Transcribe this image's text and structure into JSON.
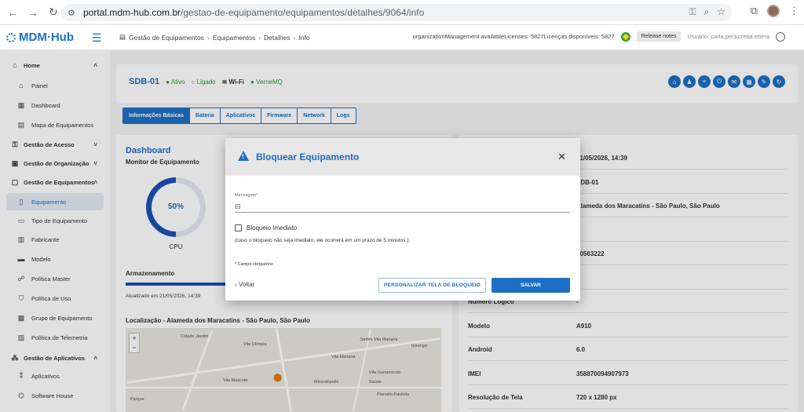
{
  "browser": {
    "url_host": "portal.mdm-hub.com.br",
    "url_path": "/gestao-de-equipamento/equipamentos/detalhes/9064/info"
  },
  "app": {
    "logo": "MDM·Hub",
    "breadcrumb": [
      "Gestão de Equipamentos",
      "Equipamentos",
      "Detalhes",
      "Info"
    ],
    "licenses_text": "organizationManagement.availableLicenses: 5827Licenças disponíveis: 5827",
    "release_notes": "Release notes",
    "user": "Usuário: carla.perazzetta.ettera"
  },
  "sidebar": {
    "items": [
      {
        "label": "Home",
        "icon": "home-icon",
        "type": "group",
        "chevron": "˄"
      },
      {
        "label": "Painel",
        "icon": "home-icon",
        "type": "child"
      },
      {
        "label": "Dashboard",
        "icon": "dashboard-icon",
        "type": "child"
      },
      {
        "label": "Mapa de Equipamentos",
        "icon": "map-icon",
        "type": "child"
      },
      {
        "label": "Gestão de Acesso",
        "icon": "access-icon",
        "type": "group",
        "chevron": "˅"
      },
      {
        "label": "Gestão de Organização",
        "icon": "organization-icon",
        "type": "group",
        "chevron": "˅"
      },
      {
        "label": "Gestão de Equipamentos",
        "icon": "equipment-icon",
        "type": "group",
        "chevron": "˄"
      },
      {
        "label": "Equipamento",
        "icon": "device-icon",
        "type": "child",
        "active": true
      },
      {
        "label": "Tipo de Equipamento",
        "icon": "device-type-icon",
        "type": "child"
      },
      {
        "label": "Fabricante",
        "icon": "manufacturer-icon",
        "type": "child"
      },
      {
        "label": "Modelo",
        "icon": "model-icon",
        "type": "child"
      },
      {
        "label": "Política Master",
        "icon": "policy-icon",
        "type": "child"
      },
      {
        "label": "Política de Uso",
        "icon": "shield-icon",
        "type": "child"
      },
      {
        "label": "Grupo de Equipamento",
        "icon": "group-icon",
        "type": "child"
      },
      {
        "label": "Política de Telemetria",
        "icon": "telemetry-icon",
        "type": "child"
      },
      {
        "label": "Gestão de Aplicativos",
        "icon": "apps-icon",
        "type": "group",
        "chevron": "˄"
      },
      {
        "label": "Aplicativos",
        "icon": "app-icon",
        "type": "child"
      },
      {
        "label": "Software House",
        "icon": "software-house-icon",
        "type": "child"
      }
    ]
  },
  "device": {
    "name": "SDB-01",
    "status_active": "● Ativo",
    "status_on": "○ Ligado",
    "wifi": "Wi-Fi",
    "broker": "● VerneMQ"
  },
  "tabs": [
    "Informações Básicas",
    "Bateria",
    "Aplicativos",
    "Firmware",
    "Network",
    "Logs"
  ],
  "dashboard": {
    "title": "Dashboard",
    "subtitle": "Monitor de Equipamento",
    "cpu_value": "50%",
    "cpu_fraction": 0.5,
    "cpu_label": "CPU",
    "storage_title": "Armazenamento",
    "storage_fraction": 0.32,
    "updated": "Atualizado em 21/05/2026, 14:39",
    "location_title": "Localização - Alameda dos Maracatins - São Paulo, São Paulo"
  },
  "map_labels": [
    "Cidade Jardim",
    "Vila Olímpia",
    "Jardim Vila Mariana",
    "Ipiranga",
    "Vila Mariana",
    "Vila Gumercindo",
    "Vila Mascote",
    "Mirandópolis",
    "Saúde",
    "Planalto Paulista",
    "Parque"
  ],
  "info": [
    {
      "k": "",
      "v": "21/05/2026, 14:39"
    },
    {
      "k": "",
      "v": "SDB-01"
    },
    {
      "k": "",
      "v": "Alameda dos Maracatins - São Paulo, São Paulo"
    },
    {
      "k": "",
      "v": ""
    },
    {
      "k": "",
      "v": "90563222"
    },
    {
      "k": "",
      "v": ""
    },
    {
      "k": "Número Lógico",
      "v": "-"
    },
    {
      "k": "Modelo",
      "v": "A910"
    },
    {
      "k": "Android",
      "v": "6.0"
    },
    {
      "k": "IMEI",
      "v": "358870094907973"
    },
    {
      "k": "Resolução de Tela",
      "v": "720 x 1280 px"
    }
  ],
  "modal": {
    "title": "Bloquear Equipamento",
    "message_label": "Mensagem*",
    "checkbox_label": "Bloqueio Imediato",
    "checkbox_note": "(caso o bloqueio não seja imediato, ele ocorrerá em um prazo de 5 minutos.).",
    "required_note": "* Campo obrigatório",
    "back": "‹ Voltar",
    "customize": "PERSONALIZAR TELA DE BLOQUEIO",
    "save": "SALVAR"
  }
}
